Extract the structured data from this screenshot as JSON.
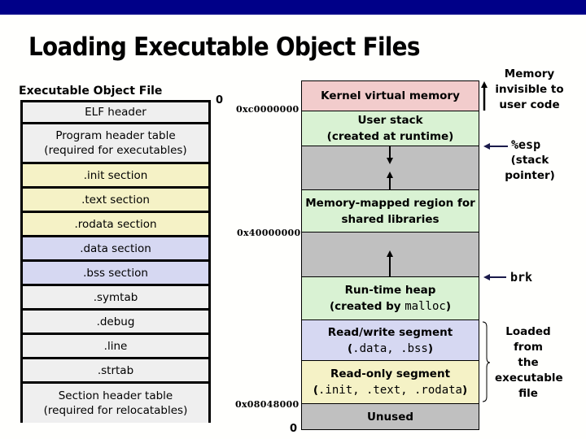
{
  "title": "Loading Executable Object Files",
  "left": {
    "heading": "Executable Object File",
    "offset_zero": "0",
    "rows": [
      {
        "lines": [
          "ELF header"
        ],
        "color": "#efefef"
      },
      {
        "lines": [
          "Program header table",
          "(required for executables)"
        ],
        "color": "#efefef"
      },
      {
        "lines": [
          ".init section"
        ],
        "color": "#f5f2c6"
      },
      {
        "lines": [
          ".text section"
        ],
        "color": "#f5f2c6"
      },
      {
        "lines": [
          ".rodata section"
        ],
        "color": "#f5f2c6"
      },
      {
        "lines": [
          ".data section"
        ],
        "color": "#d6d8f2"
      },
      {
        "lines": [
          ".bss section"
        ],
        "color": "#d6d8f2"
      },
      {
        "lines": [
          ".symtab"
        ],
        "color": "#efefef"
      },
      {
        "lines": [
          ".debug"
        ],
        "color": "#efefef"
      },
      {
        "lines": [
          ".line"
        ],
        "color": "#efefef"
      },
      {
        "lines": [
          ".strtab"
        ],
        "color": "#efefef"
      },
      {
        "lines": [
          "Section header table",
          "(required for relocatables)"
        ],
        "color": "#efefef"
      }
    ]
  },
  "right": {
    "rows": [
      {
        "line1": "Kernel virtual memory",
        "line2": "",
        "color": "#f2cccc"
      },
      {
        "line1": "User stack",
        "line2": "(created at runtime)",
        "color": "#d9f2d3"
      },
      {
        "line1": "",
        "line2": "",
        "color": "#c0c0c0"
      },
      {
        "line1": "Memory-mapped region for",
        "line2": "shared libraries",
        "color": "#d9f2d3"
      },
      {
        "line1": "",
        "line2": "",
        "color": "#c0c0c0"
      },
      {
        "line1": "Run-time heap",
        "line2_prefix": "(created by ",
        "line2_code": "malloc",
        "line2_suffix": ")",
        "color": "#d9f2d3"
      },
      {
        "line1": "Read/write segment",
        "line2_prefix": "(",
        "line2_code": ".data, .bss",
        "line2_suffix": ")",
        "color": "#d6d8f2"
      },
      {
        "line1": "Read-only segment",
        "line2_prefix": "(",
        "line2_code": ".init, .text, .rodata",
        "line2_suffix": ")",
        "color": "#f5f2c6"
      },
      {
        "line1": "Unused",
        "line2": "",
        "color": "#c0c0c0"
      }
    ],
    "addresses": {
      "kernel": "0xc0000000",
      "shared": "0x40000000",
      "text": "0x08048000",
      "zero": "0"
    }
  },
  "annotations": {
    "invisible": [
      "Memory",
      "invisible to",
      "user code"
    ],
    "esp": "%esp",
    "esp_desc": [
      "(stack",
      "pointer)"
    ],
    "brk": "brk",
    "loaded": [
      "Loaded",
      "from",
      "the",
      "executable",
      "file"
    ]
  },
  "colors": {
    "topbar": "#000088",
    "arrow": "#1a1a4a"
  }
}
